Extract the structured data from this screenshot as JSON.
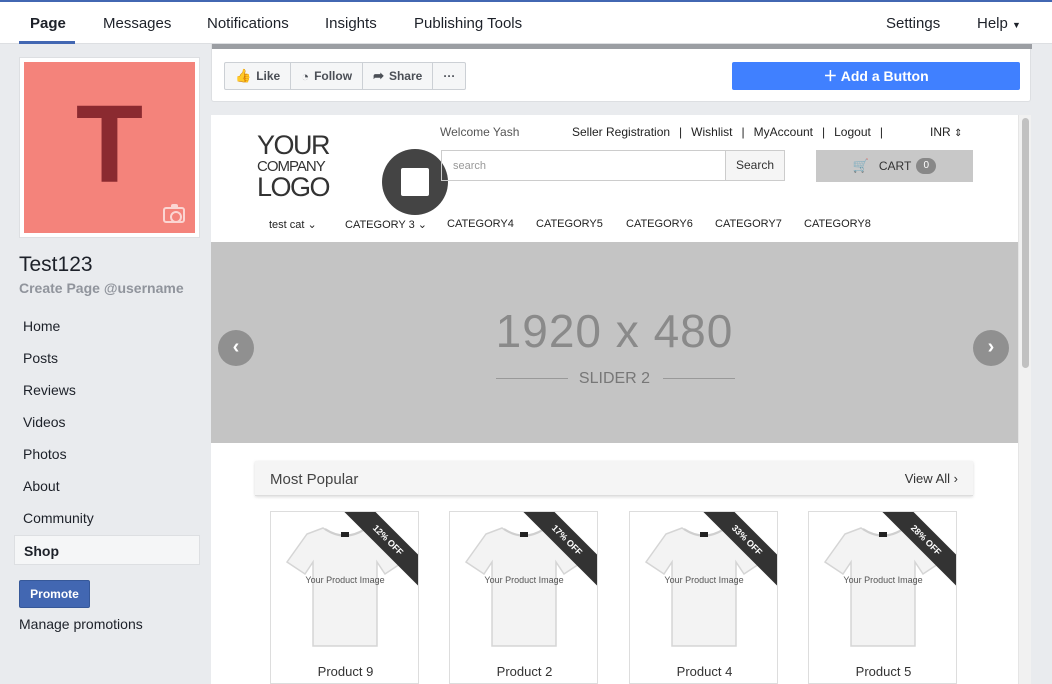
{
  "topnav": {
    "tabs": [
      {
        "label": "Page",
        "active": true
      },
      {
        "label": "Messages"
      },
      {
        "label": "Notifications"
      },
      {
        "label": "Insights"
      },
      {
        "label": "Publishing Tools"
      }
    ],
    "settings": "Settings",
    "help": "Help"
  },
  "profile": {
    "letter": "T",
    "name": "Test123",
    "username": "Create Page @username",
    "cover_color": "#f4837b"
  },
  "sidebar": {
    "items": [
      {
        "label": "Home"
      },
      {
        "label": "Posts"
      },
      {
        "label": "Reviews"
      },
      {
        "label": "Videos"
      },
      {
        "label": "Photos"
      },
      {
        "label": "About"
      },
      {
        "label": "Community"
      },
      {
        "label": "Shop",
        "active": true
      }
    ],
    "promote": "Promote",
    "manage": "Manage promotions"
  },
  "actions": {
    "like": "Like",
    "follow": "Follow",
    "share": "Share",
    "more": "···",
    "add_button": "Add a Button",
    "accent": "#4080ff"
  },
  "shop": {
    "logo": {
      "line1": "YOUR",
      "line2": "COMPANY",
      "line3": "LOGO"
    },
    "welcome": "Welcome Yash",
    "links": [
      "Seller Registration",
      "Wishlist",
      "MyAccount",
      "Logout"
    ],
    "currency": "INR",
    "search_placeholder": "search",
    "search_button": "Search",
    "cart_label": "CART",
    "cart_count": "0",
    "categories": [
      "test cat",
      "CATEGORY 3",
      "CATEGORY4",
      "CATEGORY5",
      "CATEGORY6",
      "CATEGORY7",
      "CATEGORY8"
    ],
    "slider": {
      "dimensions": "1920 x 480",
      "label": "SLIDER 2"
    },
    "popular_title": "Most Popular",
    "view_all": "View All",
    "product_image_text": "Your Product Image",
    "products": [
      {
        "name": "Product 9",
        "discount": "12% OFF"
      },
      {
        "name": "Product 2",
        "discount": "17% OFF"
      },
      {
        "name": "Product 4",
        "discount": "33% OFF"
      },
      {
        "name": "Product 5",
        "discount": "28% OFF"
      }
    ]
  }
}
